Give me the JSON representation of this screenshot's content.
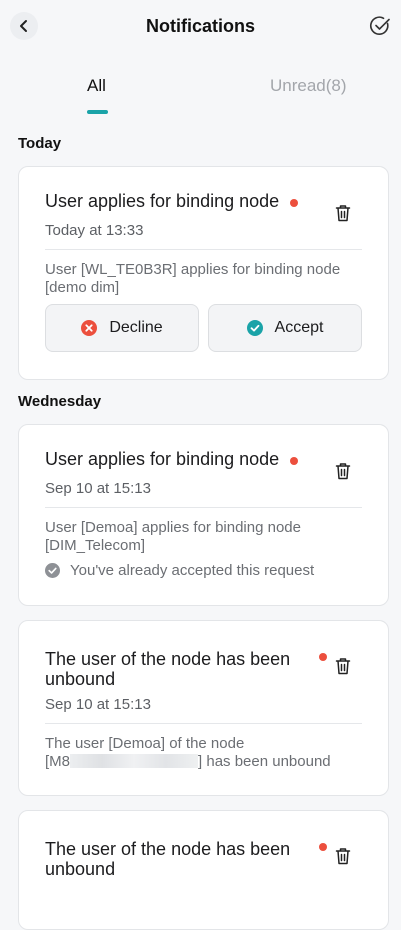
{
  "header": {
    "title": "Notifications"
  },
  "tabs": [
    {
      "label": "All"
    },
    {
      "label": "Unread(8)"
    }
  ],
  "sections": [
    {
      "label": "Today"
    },
    {
      "label": "Wednesday"
    }
  ],
  "notifications": [
    {
      "title": "User applies for binding node",
      "time": "Today at 13:33",
      "body": "User [WL_TE0B3R] applies for binding node [demo dim]",
      "actions": {
        "decline": "Decline",
        "accept": "Accept"
      }
    },
    {
      "title": "User applies for binding node",
      "time": "Sep 10 at 15:13",
      "body": "User [Demoa] applies for binding node [DIM_Telecom]",
      "status": "You've already accepted this request"
    },
    {
      "title": "The user of the node has been unbound",
      "time": "Sep 10 at 15:13",
      "body_prefix": "The user [Demoa] of the node",
      "body_line2_prefix": "[M8",
      "body_suffix": "] has been unbound"
    },
    {
      "title": "The user of the node has been unbound"
    }
  ],
  "colors": {
    "accent": "#1aa3a8",
    "unread_dot": "#ec4f3d",
    "decline_icon": "#ec4f3d",
    "accept_icon": "#1aa3a8",
    "accepted_status_icon": "#8e9196"
  },
  "icons": {
    "back": "chevron-left-icon",
    "mark_all_read": "check-circle-icon",
    "delete": "trash-icon",
    "decline": "x-circle-icon",
    "accept": "check-circle-filled-icon"
  }
}
